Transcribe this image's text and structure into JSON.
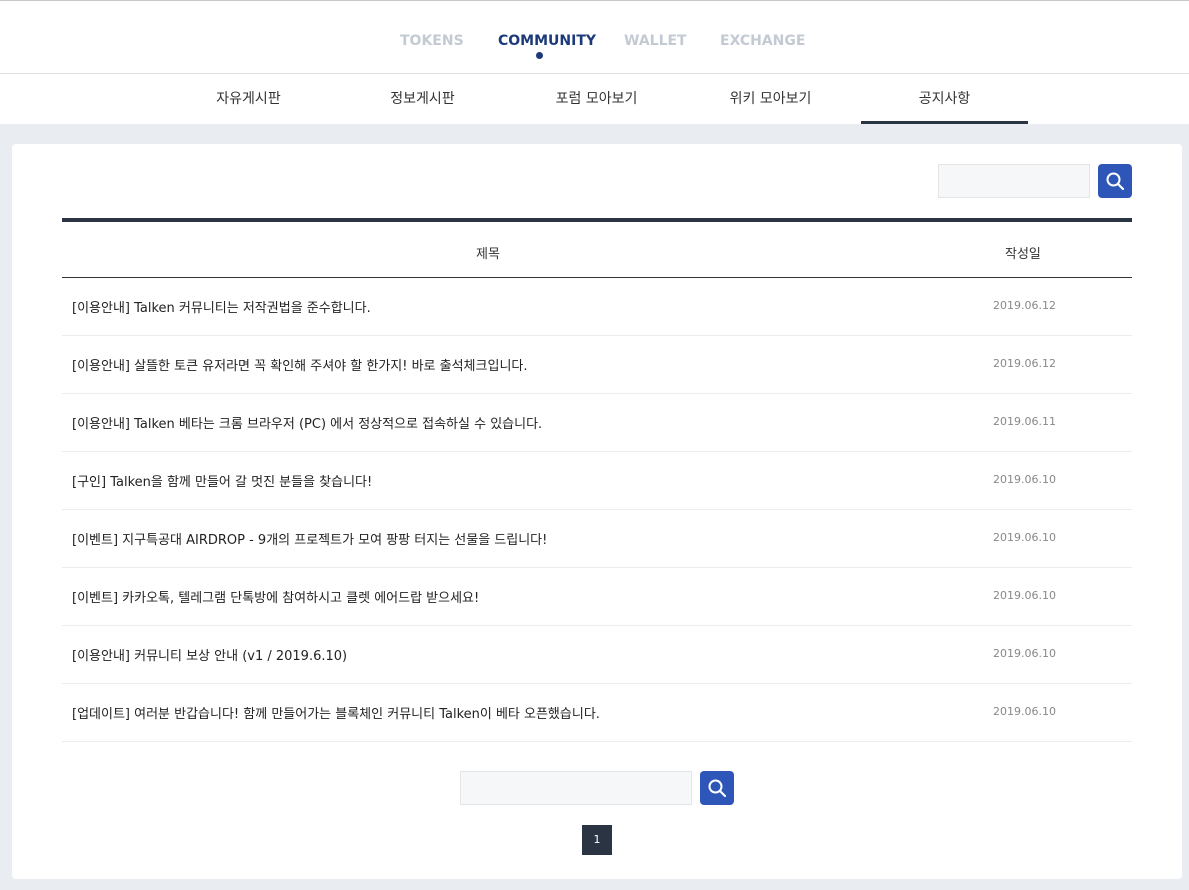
{
  "main_nav": {
    "items": [
      {
        "label": "TOKENS"
      },
      {
        "label": "COMMUNITY"
      },
      {
        "label": "WALLET"
      },
      {
        "label": "EXCHANGE"
      }
    ],
    "active_index": 1
  },
  "sub_nav": {
    "items": [
      {
        "label": "자유게시판"
      },
      {
        "label": "정보게시판"
      },
      {
        "label": "포럼 모아보기"
      },
      {
        "label": "위키 모아보기"
      },
      {
        "label": "공지사항"
      }
    ],
    "active_index": 4
  },
  "search": {
    "top_value": "",
    "bottom_value": "",
    "button_icon": "search-icon"
  },
  "table": {
    "headers": {
      "title": "제목",
      "date": "작성일"
    },
    "rows": [
      {
        "title": "[이용안내] Talken 커뮤니티는 저작권법을 준수합니다.",
        "date": "2019.06.12"
      },
      {
        "title": "[이용안내] 살뜰한 토큰 유저라면 꼭 확인해 주셔야 할 한가지! 바로 출석체크입니다.",
        "date": "2019.06.12"
      },
      {
        "title": "[이용안내] Talken 베타는 크롬 브라우저 (PC) 에서 정상적으로 접속하실 수 있습니다.",
        "date": "2019.06.11"
      },
      {
        "title": "[구인] Talken을 함께 만들어 갈 멋진 분들을 찾습니다!",
        "date": "2019.06.10"
      },
      {
        "title": "[이벤트] 지구특공대 AIRDROP - 9개의 프로젝트가 모여 팡팡 터지는 선물을 드립니다!",
        "date": "2019.06.10"
      },
      {
        "title": "[이벤트] 카카오톡, 텔레그램 단톡방에 참여하시고 클렛 에어드랍 받으세요!",
        "date": "2019.06.10"
      },
      {
        "title": "[이용안내] 커뮤니티 보상 안내 (v1 / 2019.6.10)",
        "date": "2019.06.10"
      },
      {
        "title": "[업데이트] 여러분 반갑습니다! 함께 만들어가는 블록체인 커뮤니티 Talken이 베타 오픈했습니다.",
        "date": "2019.06.10"
      }
    ]
  },
  "pagination": {
    "current": "1"
  },
  "colors": {
    "accent": "#2e55b8",
    "nav_active": "#1c3a7a",
    "dark": "#2b3443"
  }
}
